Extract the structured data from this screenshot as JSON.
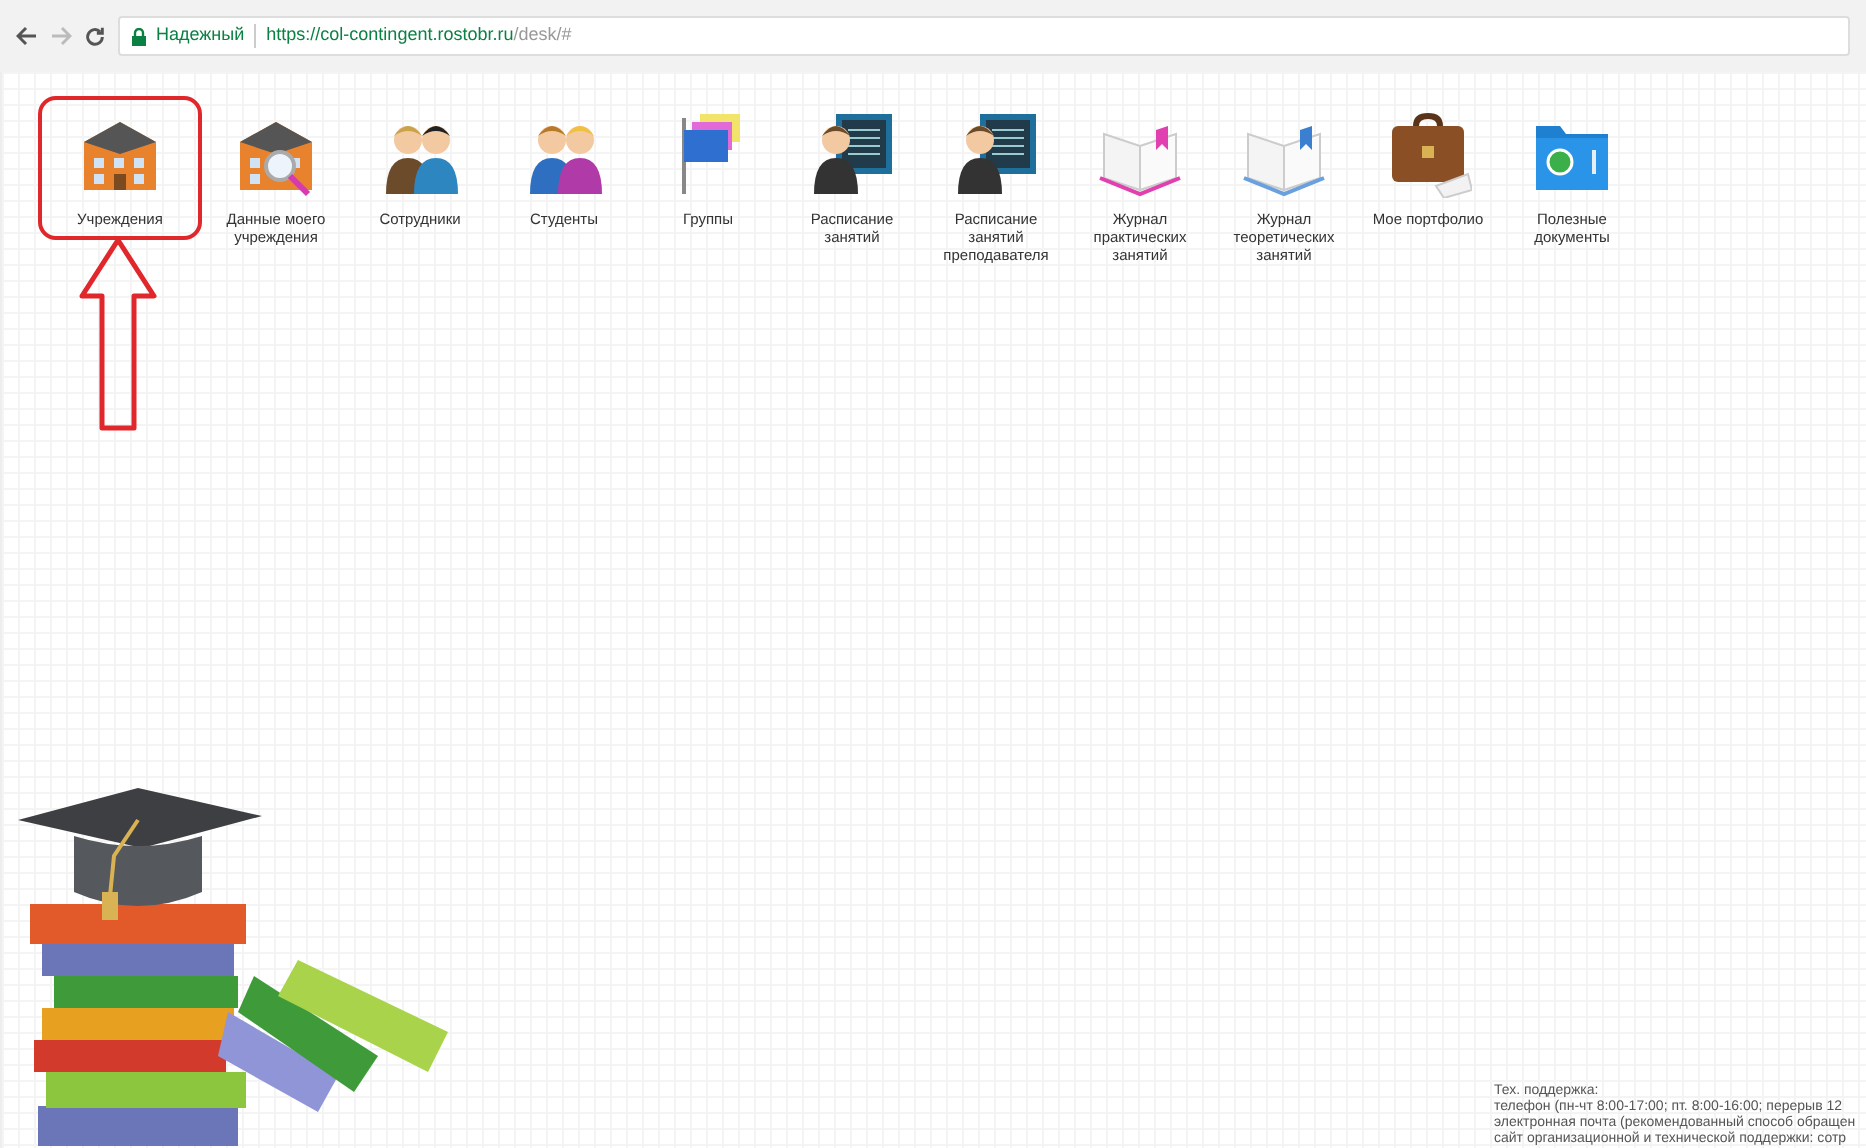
{
  "browser": {
    "security_label": "Надежный",
    "url_host": "https://col-contingent.rostobr.ru",
    "url_path": "/desk/#"
  },
  "desktop_items": [
    {
      "label": "Учреждения",
      "kind": "building",
      "highlighted": true
    },
    {
      "label": "Данные моего учреждения",
      "kind": "building-search",
      "highlighted": false
    },
    {
      "label": "Сотрудники",
      "kind": "staff",
      "highlighted": false
    },
    {
      "label": "Студенты",
      "kind": "students",
      "highlighted": false
    },
    {
      "label": "Группы",
      "kind": "flags",
      "highlighted": false
    },
    {
      "label": "Расписание занятий",
      "kind": "schedule",
      "highlighted": false
    },
    {
      "label": "Расписание занятий преподавателя",
      "kind": "schedule",
      "highlighted": false
    },
    {
      "label": "Журнал практических занятий",
      "kind": "journal-pink",
      "highlighted": false
    },
    {
      "label": "Журнал теоретических занятий",
      "kind": "journal-blue",
      "highlighted": false
    },
    {
      "label": "Мое портфолио",
      "kind": "briefcase",
      "highlighted": false
    },
    {
      "label": "Полезные документы",
      "kind": "folder",
      "highlighted": false
    }
  ],
  "support": {
    "title": "Тех. поддержка:",
    "lines": [
      "телефон (пн-чт 8:00-17:00; пт. 8:00-16:00; перерыв 12",
      "электронная почта (рекомендованный способ обращен",
      "сайт организационной и технической поддержки: сотр"
    ]
  }
}
